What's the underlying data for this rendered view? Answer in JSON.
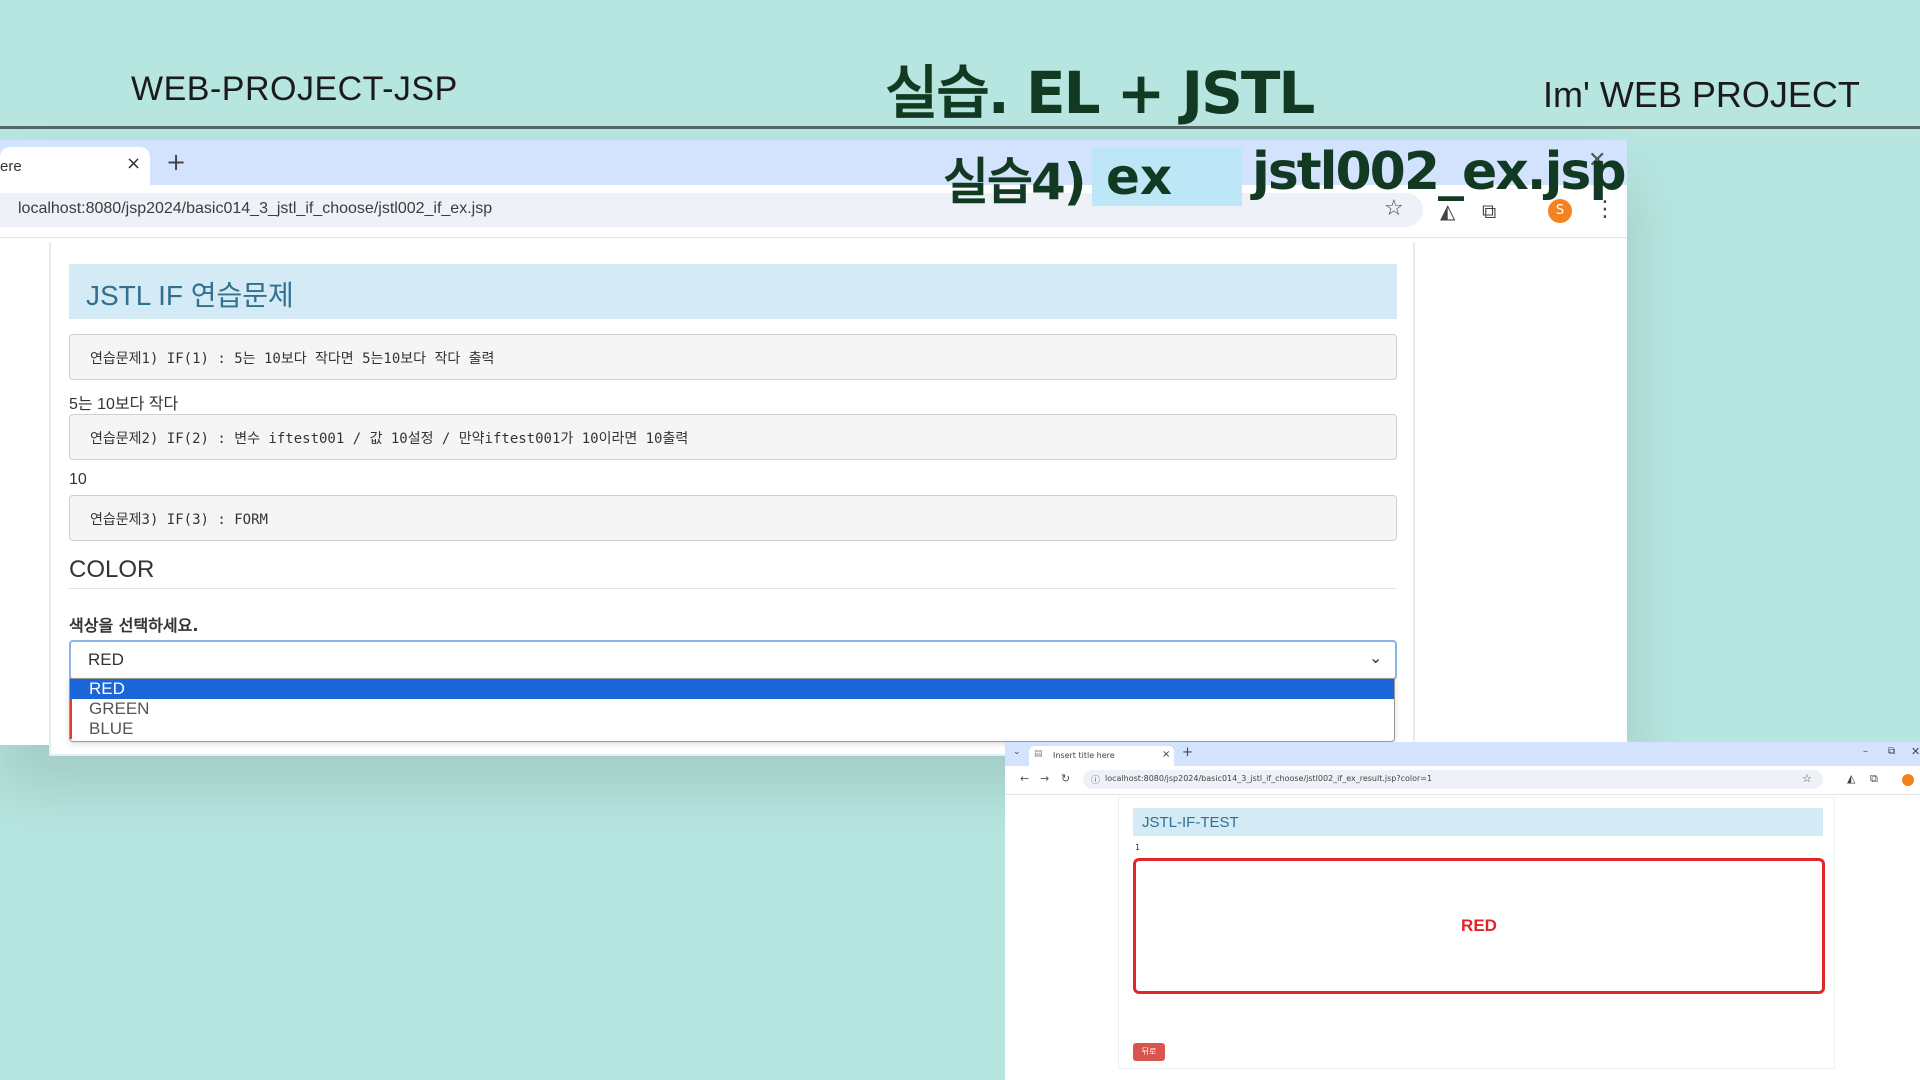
{
  "slide": {
    "left_title": "WEB-PROJECT-JSP",
    "center_title": "실습. EL + JSTL",
    "right_title": "Im'  WEB PROJECT",
    "overlay_prefix": "실습4)",
    "overlay_ex": "ex",
    "overlay_file": "jstl002_ex.jsp"
  },
  "browser": {
    "tab_title": "ere",
    "tab_close": "×",
    "tab_new": "+",
    "window_close": "✕",
    "url": "localhost:8080/jsp2024/basic014_3_jstl_if_choose/jstl002_if_ex.jsp",
    "avatar_letter": "S"
  },
  "page": {
    "banner": "JSTL IF 연습문제",
    "ex1_code": "연습문제1) IF(1) : 5는 10보다 작다면 5는10보다 작다 출력",
    "ex1_output": "5는 10보다 작다",
    "ex2_code": "연습문제2) IF(2) : 변수 iftest001 / 값 10설정 / 만약iftest001가 10이라면 10출력",
    "ex2_output": "10",
    "ex3_code": "연습문제3) IF(3) : FORM",
    "color_heading": "COLOR",
    "select_label": "색상을 선택하세요.",
    "select_value": "RED",
    "options": [
      "RED",
      "GREEN",
      "BLUE"
    ]
  },
  "result_browser": {
    "tab_title": "Insert title here",
    "url": "localhost:8080/jsp2024/basic014_3_jstl_if_choose/jstl002_if_ex_result.jsp?color=1",
    "banner": "JSTL-IF-TEST",
    "param_value": "1",
    "result_text": "RED",
    "back_button": "뒤로"
  },
  "colors": {
    "slide_bg": "#b7e5df",
    "dark_green": "#123a22",
    "selected_option": "#1a66d8",
    "result_red": "#e0252b"
  }
}
